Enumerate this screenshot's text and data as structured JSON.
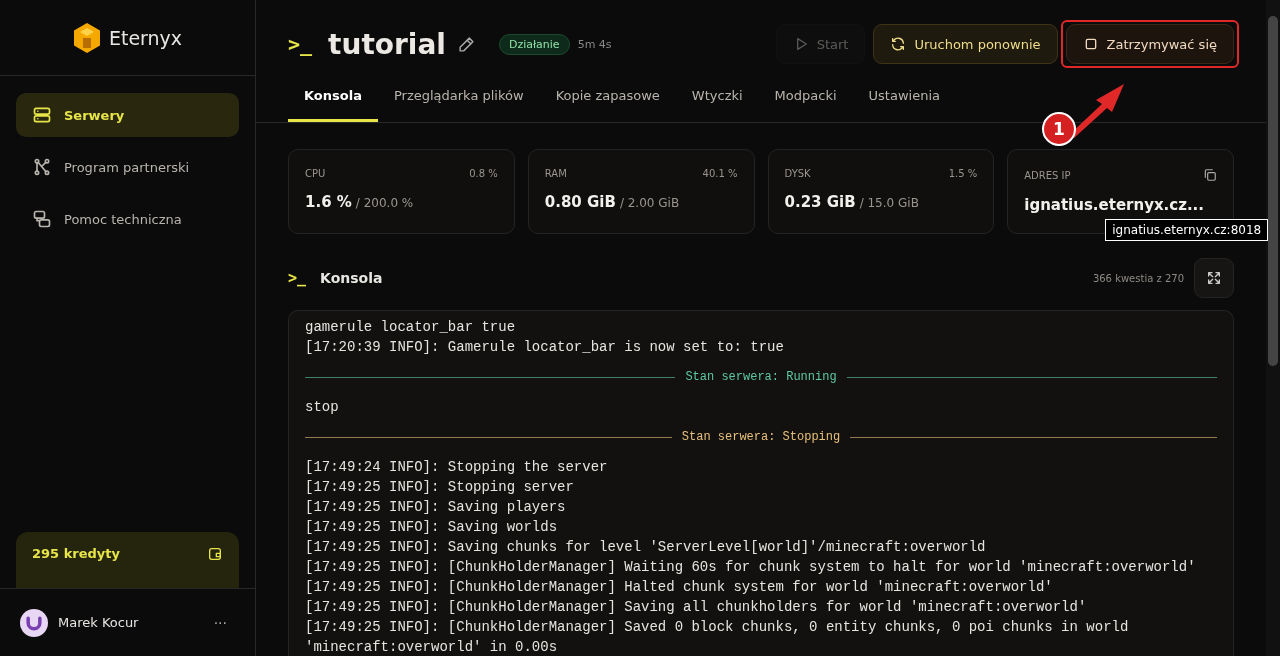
{
  "sidebar": {
    "brand": "Eternyx",
    "items": [
      {
        "label": "Serwery",
        "kind": "server",
        "selected": true
      },
      {
        "label": "Program partnerski",
        "kind": "network",
        "selected": false
      },
      {
        "label": "Pomoc techniczna",
        "kind": "chat",
        "selected": false
      }
    ],
    "credits": "295 kredyty",
    "user": {
      "name": "Marek Kocur",
      "menu": "···"
    }
  },
  "header": {
    "prompt": ">_",
    "title": "tutorial",
    "status": "Działanie",
    "uptime": "5m 4s",
    "buttons": [
      {
        "label": "Start",
        "kind": "start",
        "disabled": true
      },
      {
        "label": "Uruchom ponownie",
        "kind": "restart",
        "disabled": false
      },
      {
        "label": "Zatrzymywać się",
        "kind": "stop",
        "disabled": false
      }
    ]
  },
  "tabs": [
    {
      "label": "Konsola",
      "selected": true
    },
    {
      "label": "Przeglądarka plików",
      "selected": false
    },
    {
      "label": "Kopie zapasowe",
      "selected": false
    },
    {
      "label": "Wtyczki",
      "selected": false
    },
    {
      "label": "Modpacki",
      "selected": false
    },
    {
      "label": "Ustawienia",
      "selected": false
    }
  ],
  "stats": [
    {
      "label": "CPU",
      "percent": "0.8 %",
      "value": "1.6 %",
      "limit": "/ 200.0 %"
    },
    {
      "label": "RAM",
      "percent": "40.1 %",
      "value": "0.80 GiB",
      "limit": "/ 2.00 GiB"
    },
    {
      "label": "DYSK",
      "percent": "1.5 %",
      "value": "0.23 GiB",
      "limit": "/ 15.0 GiB"
    }
  ],
  "address": {
    "label": "ADRES IP",
    "value": "ignatius.eternyx.cz...",
    "tooltip": "ignatius.eternyx.cz:8018"
  },
  "console": {
    "prompt": ">_",
    "title": "Konsola",
    "count": "366 kwestia z 270",
    "lines": [
      {
        "kind": "log",
        "text": "gamerule locator_bar true"
      },
      {
        "kind": "log",
        "text": "[17:20:39 INFO]: Gamerule locator_bar is now set to: true"
      },
      {
        "kind": "divider",
        "text": "Stan serwera: Running",
        "color": "#5ec9a0"
      },
      {
        "kind": "log",
        "text": "stop"
      },
      {
        "kind": "divider",
        "text": "Stan serwera: Stopping",
        "color": "#e8c07a"
      },
      {
        "kind": "log",
        "text": "[17:49:24 INFO]: Stopping the server"
      },
      {
        "kind": "log",
        "text": "[17:49:25 INFO]: Stopping server"
      },
      {
        "kind": "log",
        "text": "[17:49:25 INFO]: Saving players"
      },
      {
        "kind": "log",
        "text": "[17:49:25 INFO]: Saving worlds"
      },
      {
        "kind": "log",
        "text": "[17:49:25 INFO]: Saving chunks for level 'ServerLevel[world]'/minecraft:overworld"
      },
      {
        "kind": "log",
        "text": "[17:49:25 INFO]: [ChunkHolderManager] Waiting 60s for chunk system to halt for world 'minecraft:overworld'"
      },
      {
        "kind": "log",
        "text": "[17:49:25 INFO]: [ChunkHolderManager] Halted chunk system for world 'minecraft:overworld'"
      },
      {
        "kind": "log",
        "text": "[17:49:25 INFO]: [ChunkHolderManager] Saving all chunkholders for world 'minecraft:overworld'"
      },
      {
        "kind": "log",
        "text": "[17:49:25 INFO]: [ChunkHolderManager] Saved 0 block chunks, 0 entity chunks, 0 poi chunks in world 'minecraft:overworld' in 0.00s"
      }
    ]
  },
  "annotation": {
    "number": "1"
  }
}
